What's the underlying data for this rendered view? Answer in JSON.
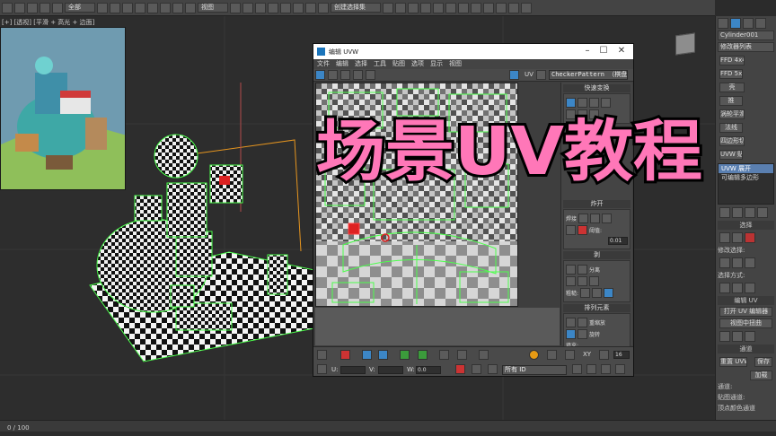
{
  "toolbar": {
    "selection_filter": "全部",
    "ref_coord": "视图",
    "named_selection": "创建选择集"
  },
  "viewport": {
    "label": "[+] [透视] [平滑 + 高光 + 边面]"
  },
  "uvw_editor": {
    "title": "编辑 UVW",
    "menu": [
      "文件",
      "编辑",
      "选择",
      "工具",
      "贴图",
      "选项",
      "显示",
      "视图"
    ],
    "uv_label": "UV",
    "texture_dropdown": "CheckerPattern  （棋盘",
    "right_panel": {
      "quick_transform": "快速变换",
      "stitch": "炸开",
      "weld": "焊接",
      "threshold_label": "阈值:",
      "threshold_value": "0.01",
      "peel": "剥",
      "detach": "分离",
      "pin": "粗糙:",
      "arrange": "排列元素",
      "rescale": "重缩放",
      "rotate": "旋转",
      "padding": "填充:"
    },
    "bottom": {
      "u_label": "U:",
      "v_label": "V:",
      "w_label": "W:",
      "w_value": "0.0",
      "xy_label": "XY",
      "zoom_value": "16",
      "all_ids": "所有 ID"
    }
  },
  "command_panel": {
    "object_name": "Cylinder001",
    "modifier_list": "修改器列表",
    "buttons": [
      "FFD 4x4x4",
      "FFD 5x",
      "壳",
      "推",
      "涡轮平滑",
      "法线",
      "四边形切角",
      "UVW 贴"
    ],
    "stack": [
      "UVW 展开",
      "可编辑多边形"
    ],
    "selection_head": "选择",
    "modify_selection": "修改选择:",
    "selection_mode": "选择方式:",
    "edit_uv_head": "编辑 UV",
    "open_uv_editor": "打开 UV 编辑器",
    "view_align": "视图中扭曲",
    "channel_head": "通道",
    "reset_uvw": "重置 UVW",
    "save": "保存",
    "load": "加载",
    "channel_label": "通道:",
    "map_channel": "贴图通道:",
    "vertex_color": "顶点颜色通道"
  },
  "timeline": {
    "frame_label": "0 / 100"
  },
  "overlay": {
    "title": "场景UV教程"
  },
  "colors": {
    "overlay_fill": "#ff77b8",
    "overlay_stroke": "#000000",
    "uv_green": "#4cff4c",
    "accent_blue": "#3c86c6",
    "bbox_orange": "#e6951f"
  }
}
